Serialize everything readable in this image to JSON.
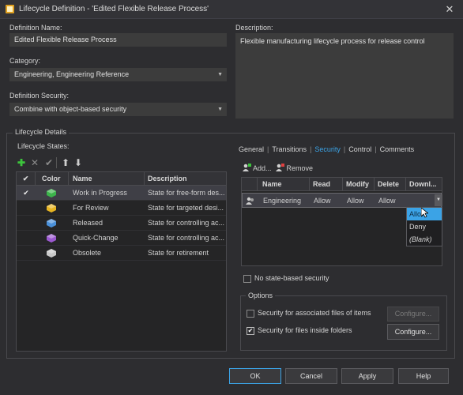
{
  "window": {
    "title": "Lifecycle Definition - 'Edited Flexible Release Process'",
    "close_glyph": "✕"
  },
  "definition_name": {
    "label": "Definition Name:",
    "value": "Edited Flexible Release Process"
  },
  "category": {
    "label": "Category:",
    "value": "Engineering, Engineering Reference"
  },
  "definition_security": {
    "label": "Definition Security:",
    "value": "Combine with object-based security"
  },
  "description": {
    "label": "Description:",
    "value": "Flexible manufacturing lifecycle process for release control"
  },
  "lifecycle_details": {
    "group_title": "Lifecycle Details",
    "states_label": "Lifecycle States:",
    "toolbar_icons": [
      "add-icon",
      "delete-icon",
      "check-icon",
      "move-up-icon",
      "move-down-icon"
    ],
    "columns": [
      "✔",
      "Color",
      "Name",
      "Description"
    ],
    "states": [
      {
        "default": "✔",
        "name": "Work in Progress",
        "description": "State for free-form des...",
        "color": "#3cb44b",
        "selected": true
      },
      {
        "default": "",
        "name": "For Review",
        "description": "State for targeted desi...",
        "color": "#e6b422",
        "selected": false
      },
      {
        "default": "",
        "name": "Released",
        "description": "State for controlling ac...",
        "color": "#4a90d9",
        "selected": false
      },
      {
        "default": "",
        "name": "Quick-Change",
        "description": "State for controlling ac...",
        "color": "#9b59d0",
        "selected": false
      },
      {
        "default": "",
        "name": "Obsolete",
        "description": "State for retirement",
        "color": "#c8c8c8",
        "selected": false
      }
    ]
  },
  "tabs": [
    {
      "label": "General",
      "active": false
    },
    {
      "label": "Transitions",
      "active": false
    },
    {
      "label": "Security",
      "active": true
    },
    {
      "label": "Control",
      "active": false
    },
    {
      "label": "Comments",
      "active": false
    }
  ],
  "tab_separator": "|",
  "security": {
    "add_label": "Add...",
    "remove_label": "Remove",
    "columns": [
      "Name",
      "Read",
      "Modify",
      "Delete",
      "Downl..."
    ],
    "rows": [
      {
        "name": "Engineering",
        "read": "Allow",
        "modify": "Allow",
        "delete": "Allow",
        "download": ""
      }
    ],
    "dropdown_options": [
      "Allow",
      "Deny",
      "(Blank)"
    ],
    "dropdown_highlight": "Allow",
    "no_state_based": {
      "label": "No state-based security",
      "checked": false
    }
  },
  "options": {
    "group_title": "Options",
    "associated_files": {
      "label": "Security for associated files of items",
      "checked": false,
      "button": "Configure...",
      "button_enabled": false
    },
    "inside_folders": {
      "label": "Security for files inside folders",
      "checked": true,
      "button": "Configure...",
      "button_enabled": true
    }
  },
  "footer": {
    "ok": "OK",
    "cancel": "Cancel",
    "apply": "Apply",
    "help": "Help"
  },
  "colors": {
    "accent": "#3ba3e6",
    "background": "#2d2d30",
    "field": "#3c3c3c"
  }
}
